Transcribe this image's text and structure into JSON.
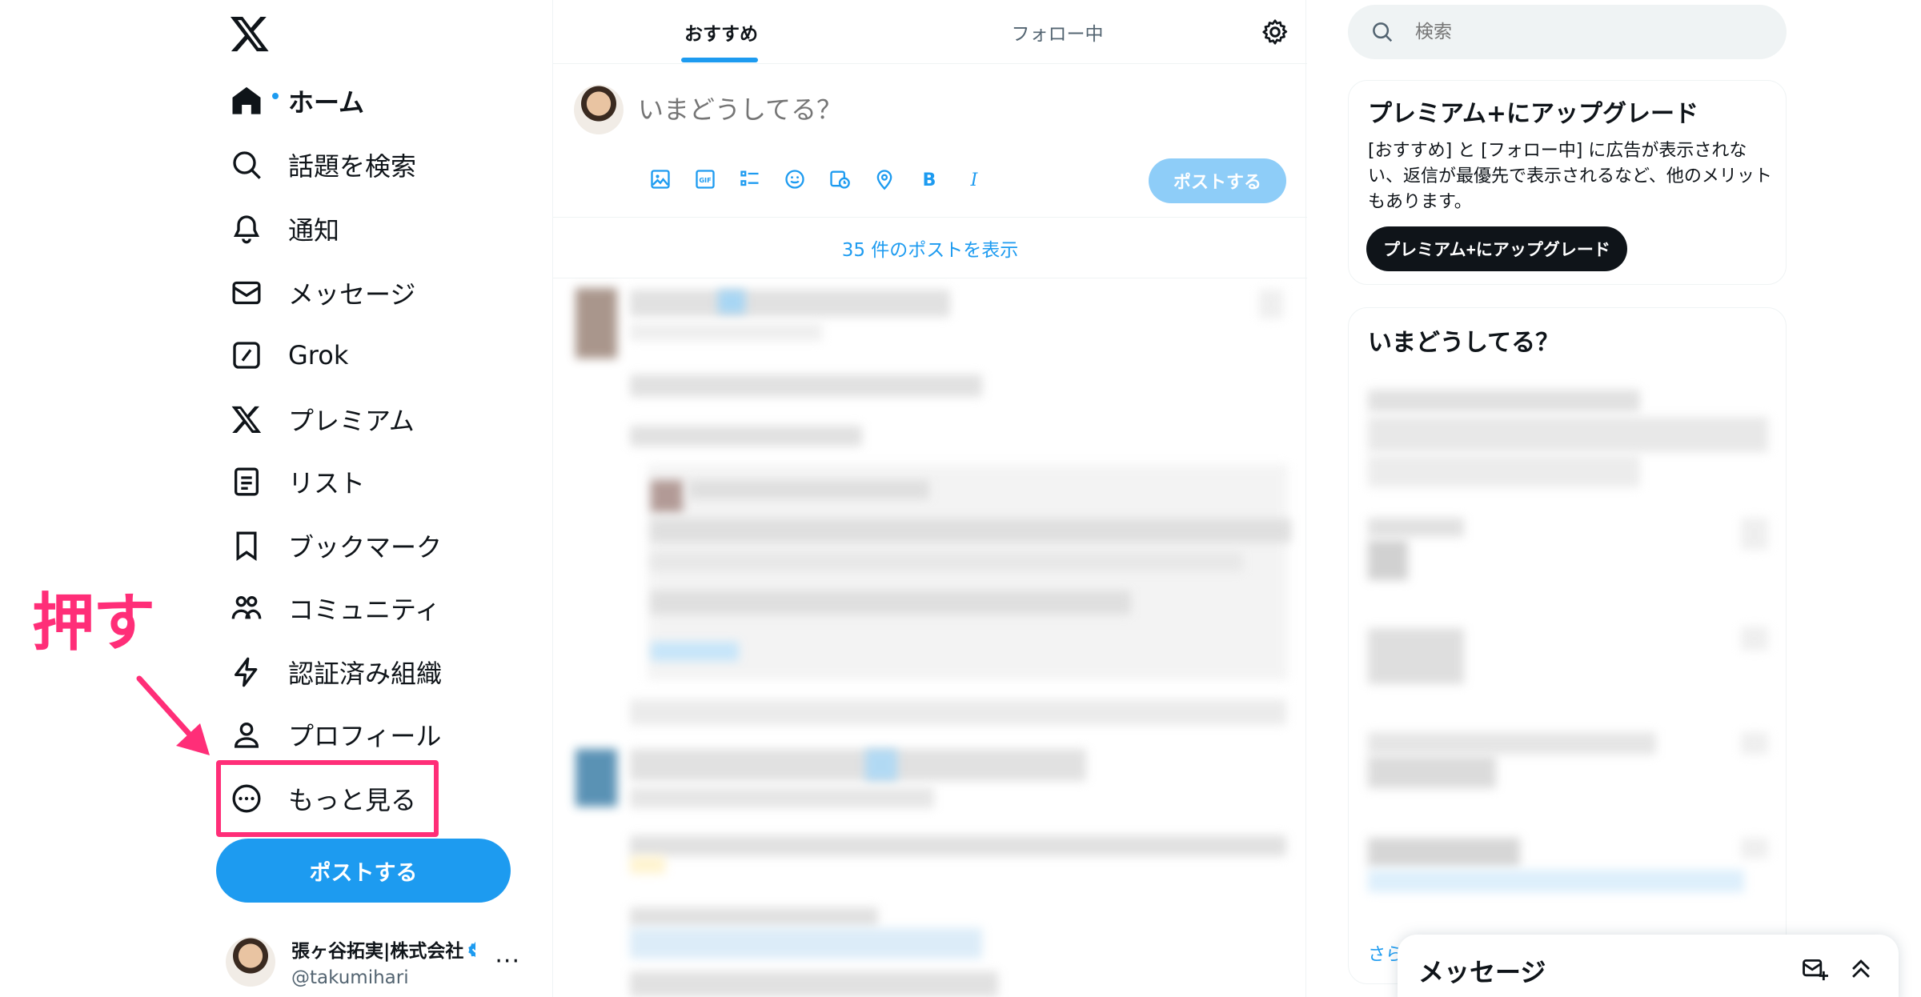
{
  "left_nav": {
    "items": [
      {
        "label": "ホーム",
        "icon": "home-icon"
      },
      {
        "label": "話題を検索",
        "icon": "search-icon"
      },
      {
        "label": "通知",
        "icon": "bell-icon"
      },
      {
        "label": "メッセージ",
        "icon": "envelope-icon"
      },
      {
        "label": "Grok",
        "icon": "grok-icon"
      },
      {
        "label": "プレミアム",
        "icon": "x-logo-icon"
      },
      {
        "label": "リスト",
        "icon": "list-icon"
      },
      {
        "label": "ブックマーク",
        "icon": "bookmark-icon"
      },
      {
        "label": "コミュニティ",
        "icon": "community-icon"
      },
      {
        "label": "認証済み組織",
        "icon": "lightning-icon"
      },
      {
        "label": "プロフィール",
        "icon": "person-icon"
      },
      {
        "label": "もっと見る",
        "icon": "more-circle-icon"
      }
    ],
    "post_button": "ポストする",
    "account": {
      "display_name": "張ヶ谷拓実|株式会社",
      "handle": "@takumihari",
      "more": "···"
    }
  },
  "annotation": {
    "text": "押す",
    "color": "#ff2e78"
  },
  "main": {
    "tabs": [
      "おすすめ",
      "フォロー中"
    ],
    "composer": {
      "placeholder": "いまどうしてる？",
      "post_button": "ポストする"
    },
    "show_posts": "35 件のポストを表示"
  },
  "right": {
    "search_placeholder": "検索",
    "premium": {
      "title": "プレミアム+にアップグレード",
      "body": "[おすすめ] と [フォロー中] に広告が表示されない、返信が最優先で表示されるなど、他のメリットもあります。",
      "button": "プレミアム+にアップグレード"
    },
    "trends": {
      "title": "いまどうしてる？",
      "more": "さら"
    },
    "messages_drawer": {
      "title": "メッセージ"
    }
  },
  "colors": {
    "accent": "#1d9bf0",
    "text": "#0f1419",
    "muted": "#536471",
    "annotation": "#ff2e78"
  }
}
